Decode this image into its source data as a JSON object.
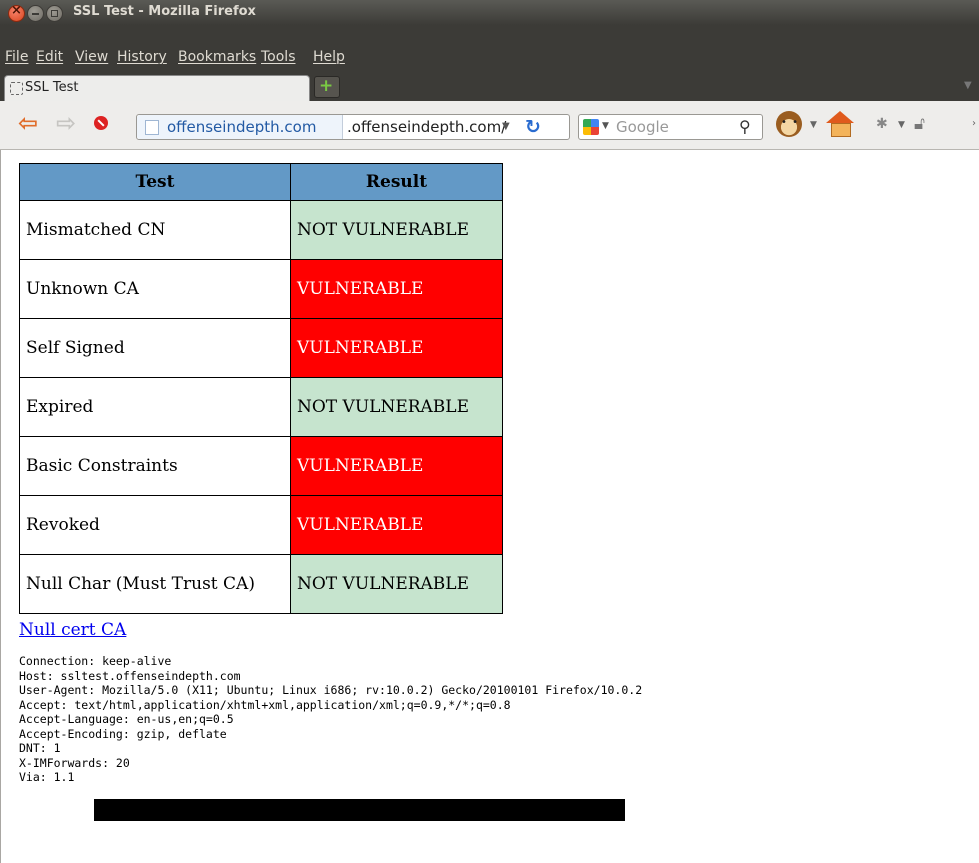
{
  "window": {
    "title": "SSL Test - Mozilla Firefox"
  },
  "menu": [
    "File",
    "Edit",
    "View",
    "History",
    "Bookmarks",
    "Tools",
    "Help"
  ],
  "tab": {
    "label": "SSL Test"
  },
  "navbar": {
    "identity_label": "offenseindepth.com",
    "url": ".offenseindepth.com/",
    "search_engine": "Google",
    "search_placeholder": "Google"
  },
  "table": {
    "headers": {
      "test": "Test",
      "result": "Result"
    },
    "rows": [
      {
        "test": "Mismatched CN",
        "result": "NOT VULNERABLE",
        "status": "ok"
      },
      {
        "test": "Unknown CA",
        "result": "VULNERABLE",
        "status": "bad"
      },
      {
        "test": "Self Signed",
        "result": "VULNERABLE",
        "status": "bad"
      },
      {
        "test": "Expired",
        "result": "NOT VULNERABLE",
        "status": "ok"
      },
      {
        "test": "Basic Constraints",
        "result": "VULNERABLE",
        "status": "bad"
      },
      {
        "test": "Revoked",
        "result": "VULNERABLE",
        "status": "bad"
      },
      {
        "test": "Null Char (Must Trust CA)",
        "result": "NOT VULNERABLE",
        "status": "ok"
      }
    ]
  },
  "link": {
    "null_cert": "Null cert CA"
  },
  "request_headers": [
    "Connection: keep-alive",
    "Host: ssltest.offenseindepth.com",
    "User-Agent: Mozilla/5.0 (X11; Ubuntu; Linux i686; rv:10.0.2) Gecko/20100101 Firefox/10.0.2",
    "Accept: text/html,application/xhtml+xml,application/xml;q=0.9,*/*;q=0.8",
    "Accept-Language: en-us,en;q=0.5",
    "Accept-Encoding: gzip, deflate",
    "DNT: 1",
    "X-IMForwards: 20",
    "Via: 1.1"
  ],
  "colors": {
    "header_bg": "#6399c6",
    "not_vulnerable_bg": "#c6e4ce",
    "vulnerable_bg": "#ff0000",
    "link": "#0000ee"
  }
}
